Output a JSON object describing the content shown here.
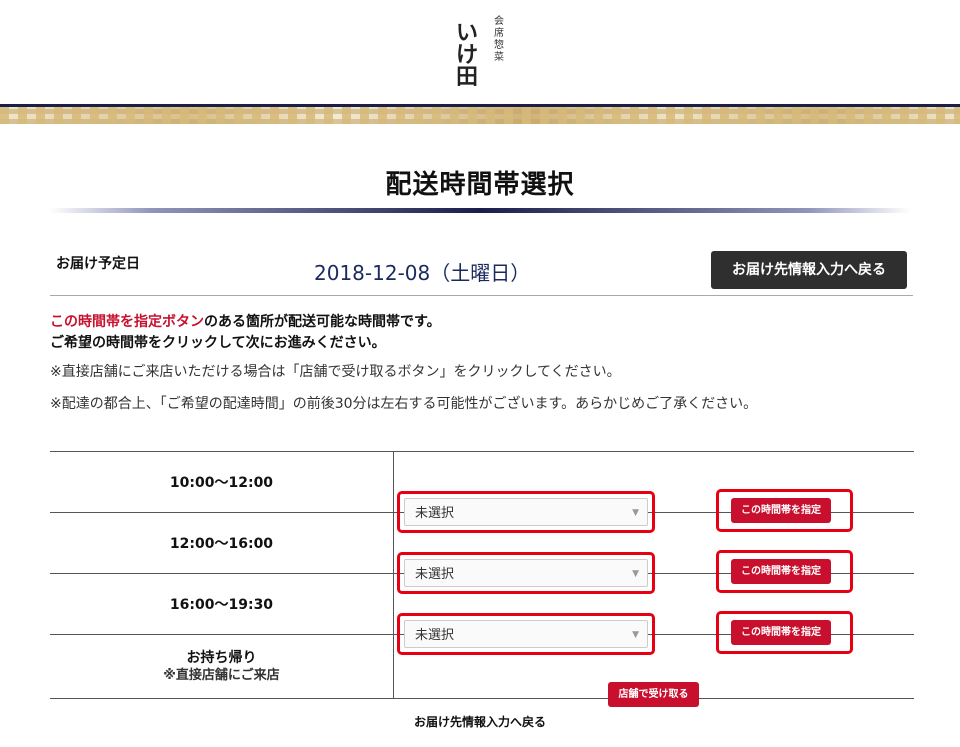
{
  "header": {
    "logo_main": "いけ田",
    "logo_sub": "会席惣菜"
  },
  "page_title": "配送時間帯選択",
  "delivery": {
    "date_label": "お届け予定日",
    "date_value": "2018-12-08（土曜日）",
    "back_button": "お届け先情報入力へ戻る"
  },
  "notes": {
    "line1_highlight": "この時間帯を指定ボタン",
    "line1_rest": "のある箇所が配送可能な時間帯です。",
    "line2": "ご希望の時間帯をクリックして次にお進みください。",
    "line3": "※直接店舗にご来店いただける場合は「店舗で受け取るボタン」をクリックしてください。",
    "line4": "※配達の都合上、「ご希望の配達時間」の前後30分は左右する可能性がございます。あらかじめご了承ください。"
  },
  "slots": [
    {
      "time": "10:00〜12:00",
      "select_value": "未選択",
      "button": "この時間帯を指定"
    },
    {
      "time": "12:00〜16:00",
      "select_value": "未選択",
      "button": "この時間帯を指定"
    },
    {
      "time": "16:00〜19:30",
      "select_value": "未選択",
      "button": "この時間帯を指定"
    }
  ],
  "pickup": {
    "title": "お持ち帰り",
    "note": "※直接店舗にご来店",
    "button": "店舗で受け取る"
  },
  "bottom_link": "お届け先情報入力へ戻る",
  "colors": {
    "accent_red": "#c8102e",
    "highlight_red": "#e60012",
    "navy": "#1b1d4a",
    "dark_button": "#2f2f2f"
  }
}
